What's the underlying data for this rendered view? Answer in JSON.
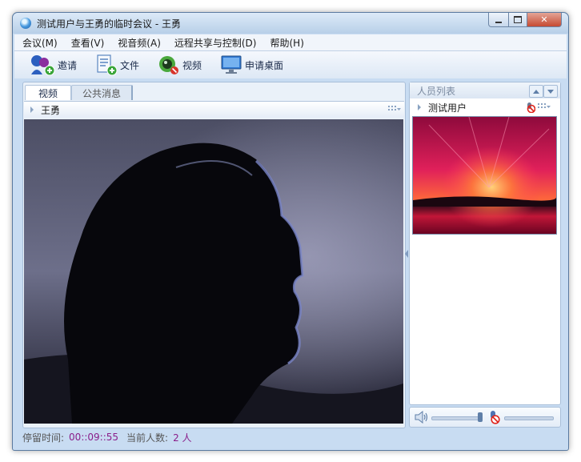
{
  "window": {
    "title": "测试用户与王勇的临时会议 - 王勇",
    "controls": {
      "minimize_icon": "minimize-icon",
      "maximize_icon": "maximize-icon",
      "close_icon": "close-icon"
    }
  },
  "menu": {
    "items": [
      {
        "label": "会议(M)"
      },
      {
        "label": "查看(V)"
      },
      {
        "label": "视音频(A)"
      },
      {
        "label": "远程共享与控制(D)"
      },
      {
        "label": "帮助(H)"
      }
    ]
  },
  "toolbar": {
    "invite": {
      "label": "邀请",
      "icon": "invite-people-icon"
    },
    "file": {
      "label": "文件",
      "icon": "file-add-icon"
    },
    "video": {
      "label": "视频",
      "icon": "video-icon"
    },
    "desktop": {
      "label": "申请桌面",
      "icon": "monitor-icon"
    }
  },
  "left_panel": {
    "tabs": [
      {
        "label": "视频",
        "active": true
      },
      {
        "label": "公共消息",
        "active": false
      }
    ],
    "video_owner": "王勇"
  },
  "right_panel": {
    "title": "人员列表",
    "participants": [
      {
        "name": "测试用户",
        "status_icon": "muted-mic-icon"
      }
    ]
  },
  "audio": {
    "speaker_icon": "speaker-icon",
    "mic_icon": "mic-muted-icon"
  },
  "status": {
    "stay_label": "停留时间:",
    "stay_value": "00::09::55",
    "people_label": "当前人数:",
    "people_value": "2 人"
  },
  "colors": {
    "accent": "#4a7bb7",
    "status_value": "#8a1e8a",
    "window_frame": "#c8dcf2"
  }
}
